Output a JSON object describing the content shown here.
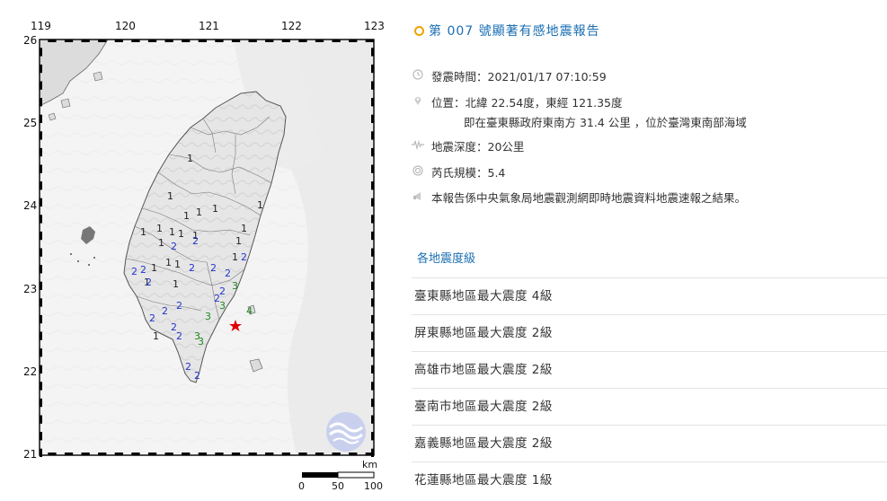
{
  "map": {
    "lon_ticks": [
      "119",
      "120",
      "121",
      "122",
      "123"
    ],
    "lat_ticks": [
      "26",
      "25",
      "24",
      "23",
      "22",
      "21"
    ],
    "scale_unit": "km",
    "scale_labels": [
      "0",
      "50",
      "100"
    ],
    "intensity_marks": [
      {
        "v": "1",
        "c": "#222"
      },
      {
        "v": "1",
        "c": "#222"
      },
      {
        "v": "1",
        "c": "#222"
      },
      {
        "v": "1",
        "c": "#222"
      },
      {
        "v": "1",
        "c": "#222"
      },
      {
        "v": "1",
        "c": "#222"
      },
      {
        "v": "1",
        "c": "#222"
      },
      {
        "v": "1",
        "c": "#222"
      },
      {
        "v": "1",
        "c": "#222"
      },
      {
        "v": "1",
        "c": "#222"
      },
      {
        "v": "1",
        "c": "#222"
      },
      {
        "v": "1",
        "c": "#222"
      },
      {
        "v": "1",
        "c": "#222"
      },
      {
        "v": "1",
        "c": "#222"
      },
      {
        "v": "1",
        "c": "#222"
      },
      {
        "v": "1",
        "c": "#222"
      },
      {
        "v": "1",
        "c": "#222"
      },
      {
        "v": "1",
        "c": "#222"
      },
      {
        "v": "1",
        "c": "#222"
      },
      {
        "v": "1",
        "c": "#222"
      },
      {
        "v": "1",
        "c": "#222"
      },
      {
        "v": "2",
        "c": "#2233cc"
      },
      {
        "v": "2",
        "c": "#2233cc"
      },
      {
        "v": "2",
        "c": "#2233cc"
      },
      {
        "v": "2",
        "c": "#2233cc"
      },
      {
        "v": "2",
        "c": "#2233cc"
      },
      {
        "v": "2",
        "c": "#2233cc"
      },
      {
        "v": "2",
        "c": "#2233cc"
      },
      {
        "v": "2",
        "c": "#2233cc"
      },
      {
        "v": "2",
        "c": "#2233cc"
      },
      {
        "v": "2",
        "c": "#2233cc"
      },
      {
        "v": "2",
        "c": "#2233cc"
      },
      {
        "v": "2",
        "c": "#2233cc"
      },
      {
        "v": "2",
        "c": "#2233cc"
      },
      {
        "v": "2",
        "c": "#2233cc"
      },
      {
        "v": "2",
        "c": "#2233cc"
      },
      {
        "v": "2",
        "c": "#2233cc"
      },
      {
        "v": "2",
        "c": "#2233cc"
      },
      {
        "v": "2",
        "c": "#2233cc"
      },
      {
        "v": "3",
        "c": "#1f8a1f"
      },
      {
        "v": "3",
        "c": "#1f8a1f"
      },
      {
        "v": "3",
        "c": "#1f8a1f"
      },
      {
        "v": "3",
        "c": "#1f8a1f"
      },
      {
        "v": "3",
        "c": "#1f8a1f"
      },
      {
        "v": "4",
        "c": "#1f8a1f"
      }
    ],
    "epicenter_color": "#e00000"
  },
  "report": {
    "title": "第 007 號顯著有感地震報告",
    "time_label": "發震時間：2021/01/17 07:10:59",
    "location_label": "位置：北緯 22.54度，東經 121.35度",
    "location_detail": "即在臺東縣政府東南方 31.4 公里 ，位於臺灣東南部海域",
    "depth_label": "地震深度：20公里",
    "magnitude_label": "芮氏規模：5.4",
    "note": "本報告係中央氣象局地震觀測網即時地震資料地震速報之結果。",
    "icons": [
      "clock-icon",
      "location-pin-icon",
      "depth-icon",
      "magnitude-icon",
      "megaphone-icon"
    ]
  },
  "intensity": {
    "heading": "各地震度級",
    "rows": [
      "臺東縣地區最大震度 4級",
      "屏東縣地區最大震度 2級",
      "高雄市地區最大震度 2級",
      "臺南市地區最大震度 2級",
      "嘉義縣地區最大震度 2級",
      "花蓮縣地區最大震度 1級"
    ]
  },
  "colors": {
    "accent": "#1a6fb3",
    "title_ring": "#f0a300",
    "divider": "#e3e3e3"
  }
}
